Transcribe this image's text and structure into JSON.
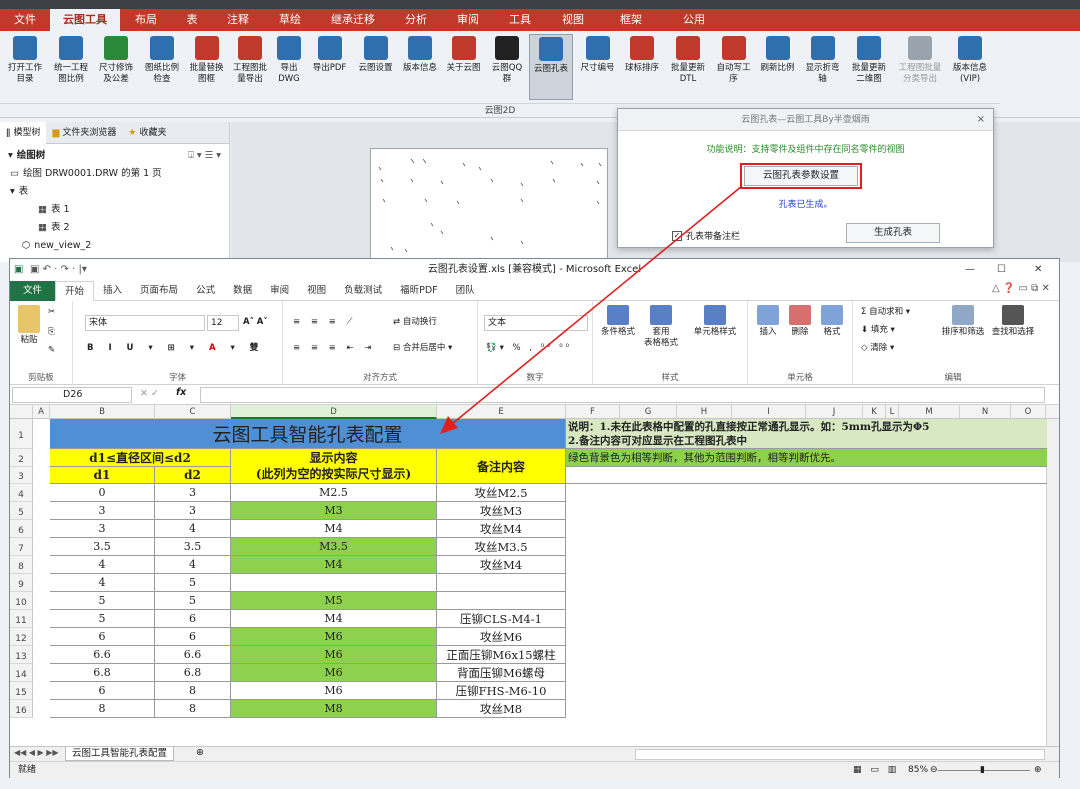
{
  "cad": {
    "tabs": [
      {
        "label": "文件",
        "active": false
      },
      {
        "label": "云图工具",
        "active": true
      },
      {
        "label": "布局",
        "active": false
      },
      {
        "label": "表",
        "active": false
      },
      {
        "label": "注释",
        "active": false
      },
      {
        "label": "草绘",
        "active": false
      },
      {
        "label": "继承迁移",
        "active": false
      },
      {
        "label": "分析",
        "active": false
      },
      {
        "label": "审阅",
        "active": false
      },
      {
        "label": "工具",
        "active": false
      },
      {
        "label": "视图",
        "active": false
      },
      {
        "label": "框架",
        "active": false
      },
      {
        "label": "公用",
        "active": false
      }
    ],
    "ribbon_buttons": [
      {
        "label": "打开工作\n目录",
        "icon": "folder-icon",
        "color": "#2f6fb0"
      },
      {
        "label": "统一工程\n图比例",
        "icon": "ruler-icon",
        "color": "#2f6fb0"
      },
      {
        "label": "尺寸修饰\n及公差",
        "icon": "dimension-icon",
        "color": "#2a8a3a"
      },
      {
        "label": "图纸比例\n检查",
        "icon": "magnifier-icon",
        "color": "#2f6fb0"
      },
      {
        "label": "批量替换\n图框",
        "icon": "frame-icon",
        "color": "#c0392b"
      },
      {
        "label": "工程图批\n量导出",
        "icon": "export-icon",
        "color": "#c0392b"
      },
      {
        "label": "导出\nDWG",
        "icon": "dwg-icon",
        "color": "#2f6fb0"
      },
      {
        "label": "导出PDF",
        "icon": "pdf-icon",
        "color": "#2f6fb0"
      },
      {
        "label": "云图设置",
        "icon": "gear-icon",
        "color": "#2f6fb0"
      },
      {
        "label": "版本信息",
        "icon": "info-icon",
        "color": "#2f6fb0"
      },
      {
        "label": "关于云图",
        "icon": "about-icon",
        "color": "#c0392b"
      },
      {
        "label": "云图QQ\n群",
        "icon": "qq-icon",
        "color": "#222222"
      },
      {
        "label": "云图孔表",
        "icon": "hole-table-icon",
        "color": "#2f6fb0"
      },
      {
        "label": "尺寸编号",
        "icon": "dim-number-icon",
        "color": "#2f6fb0"
      },
      {
        "label": "球标排序",
        "icon": "balloon-sort-icon",
        "color": "#c0392b"
      },
      {
        "label": "批量更新\nDTL",
        "icon": "dtl-icon",
        "color": "#c0392b"
      },
      {
        "label": "自动写工\n序",
        "icon": "process-icon",
        "color": "#c0392b"
      },
      {
        "label": "刷新比例",
        "icon": "refresh-scale-icon",
        "color": "#2f6fb0"
      },
      {
        "label": "显示折弯\n轴",
        "icon": "bend-axis-icon",
        "color": "#2f6fb0"
      },
      {
        "label": "批量更新\n二维图",
        "icon": "update-2d-icon",
        "color": "#2f6fb0"
      },
      {
        "label": "工程图批量\n分类导出",
        "icon": "classify-export-icon",
        "color": "#9aa3ad"
      },
      {
        "label": "版本信息\n(VIP)",
        "icon": "vip-info-icon",
        "color": "#2f6fb0"
      }
    ],
    "group_label": "云图2D",
    "side_tabs": [
      "模型树",
      "文件夹浏览器",
      "收藏夹"
    ],
    "tree": [
      "绘图树",
      "绘图 DRW0001.DRW 的第 1 页",
      "表",
      "表 1",
      "表 2",
      "new_view_2"
    ]
  },
  "dialog": {
    "title": "云图孔表—云图工具By半壶烟雨",
    "close": "×",
    "description": "功能说明：支持零件及组件中存在同名零件的视图",
    "settings_button": "云图孔表参数设置",
    "status": "孔表已生成。",
    "checkbox_label": "孔表带备注栏",
    "checkbox_checked": true,
    "generate_button": "生成孔表"
  },
  "excel": {
    "title": "云图孔表设置.xls  [兼容模式] - Microsoft Excel",
    "tabs": [
      "文件",
      "开始",
      "插入",
      "页面布局",
      "公式",
      "数据",
      "审阅",
      "视图",
      "负载测试",
      "福昕PDF",
      "团队"
    ],
    "active_tab": "开始",
    "ribbon": {
      "paste": "粘贴",
      "clipboard": "剪贴板",
      "font_name": "宋体",
      "font_size": "12",
      "font_group": "字体",
      "wrap_text": "自动换行",
      "merge_center": "合并后居中",
      "align_group": "对齐方式",
      "number_format": "文本",
      "number_group": "数字",
      "cond_format": "条件格式",
      "table_format": "套用\n表格格式",
      "cell_style": "单元格样式",
      "style_group": "样式",
      "insert": "插入",
      "delete": "删除",
      "format": "格式",
      "cells_group": "单元格",
      "autosum": "自动求和",
      "fill": "填充",
      "clear": "清除",
      "sort_filter": "排序和筛选",
      "find_select": "查找和选择",
      "edit_group": "编辑"
    },
    "name_box": "D26",
    "fx": "fx",
    "columns": [
      "A",
      "B",
      "C",
      "D",
      "E",
      "F",
      "G",
      "H",
      "I",
      "J",
      "K",
      "L",
      "M",
      "N",
      "O"
    ],
    "row_numbers": [
      "1",
      "2",
      "3",
      "4",
      "5",
      "6",
      "7",
      "8",
      "9",
      "10",
      "11",
      "12",
      "13",
      "14",
      "15",
      "16"
    ],
    "header_title": "云图工具智能孔表配置",
    "hdr_range": "d1≤直径区间≤d2",
    "hdr_d1": "d1",
    "hdr_d2": "d2",
    "hdr_display": "显示内容",
    "hdr_display_note": "(此列为空的按实际尺寸显示)",
    "hdr_remark": "备注内容",
    "notes_line1": "说明：1.未在此表格中配置的孔直接按正常通孔显示。如：5mm孔显示为Φ5",
    "notes_line2": "2.备注内容可对应显示在工程图孔表中",
    "notes_line3": "绿色背景色为相等判断，其他为范围判断，相等判断优先。",
    "rows": [
      {
        "d1": "0",
        "d2": "3",
        "display": "M2.5",
        "remark": "攻丝M2.5",
        "green": false
      },
      {
        "d1": "3",
        "d2": "3",
        "display": "M3",
        "remark": "攻丝M3",
        "green": true
      },
      {
        "d1": "3",
        "d2": "4",
        "display": "M4",
        "remark": "攻丝M4",
        "green": false
      },
      {
        "d1": "3.5",
        "d2": "3.5",
        "display": "M3.5",
        "remark": "攻丝M3.5",
        "green": true
      },
      {
        "d1": "4",
        "d2": "4",
        "display": "M4",
        "remark": "攻丝M4",
        "green": true
      },
      {
        "d1": "4",
        "d2": "5",
        "display": "",
        "remark": "",
        "green": false
      },
      {
        "d1": "5",
        "d2": "5",
        "display": "M5",
        "remark": "",
        "green": true
      },
      {
        "d1": "5",
        "d2": "6",
        "display": "M4",
        "remark": "压铆CLS-M4-1",
        "green": false
      },
      {
        "d1": "6",
        "d2": "6",
        "display": "M6",
        "remark": "攻丝M6",
        "green": true
      },
      {
        "d1": "6.6",
        "d2": "6.6",
        "display": "M6",
        "remark": "正面压铆M6x15螺柱",
        "green": true
      },
      {
        "d1": "6.8",
        "d2": "6.8",
        "display": "M6",
        "remark": "背面压铆M6螺母",
        "green": true
      },
      {
        "d1": "6",
        "d2": "8",
        "display": "M6",
        "remark": "压铆FHS-M6-10",
        "green": false
      },
      {
        "d1": "8",
        "d2": "8",
        "display": "M8",
        "remark": "攻丝M8",
        "green": true
      }
    ],
    "sheet_tab": "云图工具智能孔表配置",
    "status_ready": "就绪",
    "zoom": "85%",
    "colors": {
      "green": "#8ed14f",
      "yellow": "#ffff00",
      "blue": "#4f8fd6",
      "excel_green": "#217346"
    }
  }
}
